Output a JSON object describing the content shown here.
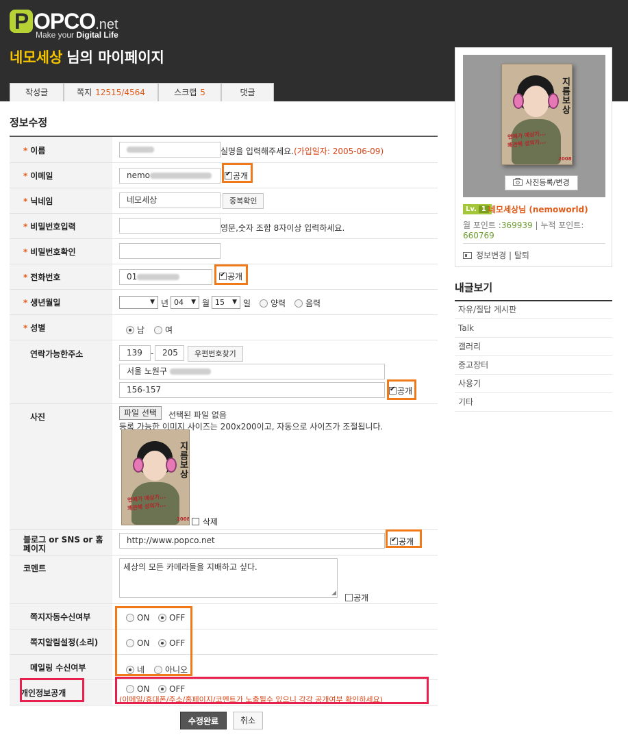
{
  "brand": {
    "logo_word": "OPCO",
    "logo_suffix": ".net",
    "logo_p": "P",
    "tagline_prefix": "Make your",
    "tagline_bold": "Digital Life"
  },
  "header": {
    "nickname": "네모세상",
    "title_suffix": "님의 마이페이지"
  },
  "tabs": [
    {
      "label": "작성글",
      "count": ""
    },
    {
      "label": "쪽지",
      "count": "12515/4564"
    },
    {
      "label": "스크랩",
      "count": "5"
    },
    {
      "label": "댓글",
      "count": ""
    }
  ],
  "form": {
    "section_title": "정보수정",
    "required_mark": "*",
    "public_label": "공개",
    "name": {
      "label": "이름",
      "help": "실명을 입력해주세요.",
      "join_date": "(가입일자: 2005-06-09)"
    },
    "email": {
      "label": "이메일",
      "value_prefix": "nemo",
      "public_checked": true
    },
    "nickname": {
      "label": "닉네임",
      "value": "네모세상",
      "check_button": "중복확인"
    },
    "password": {
      "label": "비밀번호입력",
      "help": "영문,숫자 조합 8자이상 입력하세요."
    },
    "password_confirm": {
      "label": "비밀번호확인"
    },
    "phone": {
      "label": "전화번호",
      "value_prefix": "01",
      "public_checked": true
    },
    "birth": {
      "label": "생년월일",
      "year": "",
      "year_unit": "년",
      "month": "04",
      "month_unit": "월",
      "day": "15",
      "day_unit": "일",
      "calendar_options": [
        "양력",
        "음력"
      ],
      "calendar_selected": ""
    },
    "gender": {
      "label": "성별",
      "options": [
        "남",
        "여"
      ],
      "selected": "남"
    },
    "address": {
      "label": "연락가능한주소",
      "zip1": "139",
      "zip_sep": "-",
      "zip2": "205",
      "zip_button": "우편번호찾기",
      "line1": "서울 노원구",
      "line2": "156-157",
      "public_checked": true
    },
    "photo": {
      "label": "사진",
      "file_button": "파일 선택",
      "file_status": "선택된 파일 없음",
      "size_help": "등록 가능한 이미지 사이즈는 200x200이고, 자동으로 사이즈가 조절됩니다.",
      "delete_label": "삭제",
      "delete_checked": false
    },
    "blog": {
      "label": "블로그 or SNS or 홈페이지",
      "value": "http://www.popco.net",
      "public_checked": true
    },
    "comment": {
      "label": "코멘트",
      "value": "세상의 모든 카메라들을 지배하고 싶다.",
      "public_checked": false
    },
    "auto_message": {
      "label": "쪽지자동수신여부",
      "options": [
        "ON",
        "OFF"
      ],
      "selected": "OFF"
    },
    "message_sound": {
      "label": "쪽지알림설정(소리)",
      "options": [
        "ON",
        "OFF"
      ],
      "selected": "OFF"
    },
    "mailing": {
      "label": "메일링 수신여부",
      "options": [
        "네",
        "아니오"
      ],
      "selected": "네"
    },
    "privacy": {
      "label": "개인정보공개",
      "options": [
        "ON",
        "OFF"
      ],
      "selected": "OFF",
      "warning": "(이메일/휴대폰/주소/홈페이지/코멘트가 노출될수 있으니 각각 공개여부 확인하세요)"
    },
    "submit_label": "수정완료",
    "cancel_label": "취소"
  },
  "profile": {
    "photo_button": "사진등록/변경",
    "level_prefix": "Lv.",
    "level": "1",
    "name": "네모세상님",
    "user_id": "(nemoworld)",
    "points_label": "월 포인트 :",
    "points_value": "369939",
    "points_sep": " | ",
    "total_label": "누적 포인트:",
    "total_value": "660769",
    "edit_link": "정보변경",
    "link_sep": " | ",
    "withdraw_link": "탈퇴"
  },
  "caricature": {
    "title": "지름보상",
    "tag": "2008",
    "red_line1": "연예가 예상가...",
    "red_line2": "쾌관해 성의가..."
  },
  "my_posts": {
    "title": "내글보기",
    "items": [
      "자유/질답 게시판",
      "Talk",
      "갤러리",
      "중고장터",
      "사용기",
      "기타"
    ]
  },
  "colors": {
    "header_bg": "#2e2e2e",
    "brand_green": "#b5d334",
    "nick_yellow": "#f5c400",
    "accent_orange": "#e05c1b",
    "highlight_orange": "#f07a1a",
    "highlight_red": "#e8204d"
  }
}
